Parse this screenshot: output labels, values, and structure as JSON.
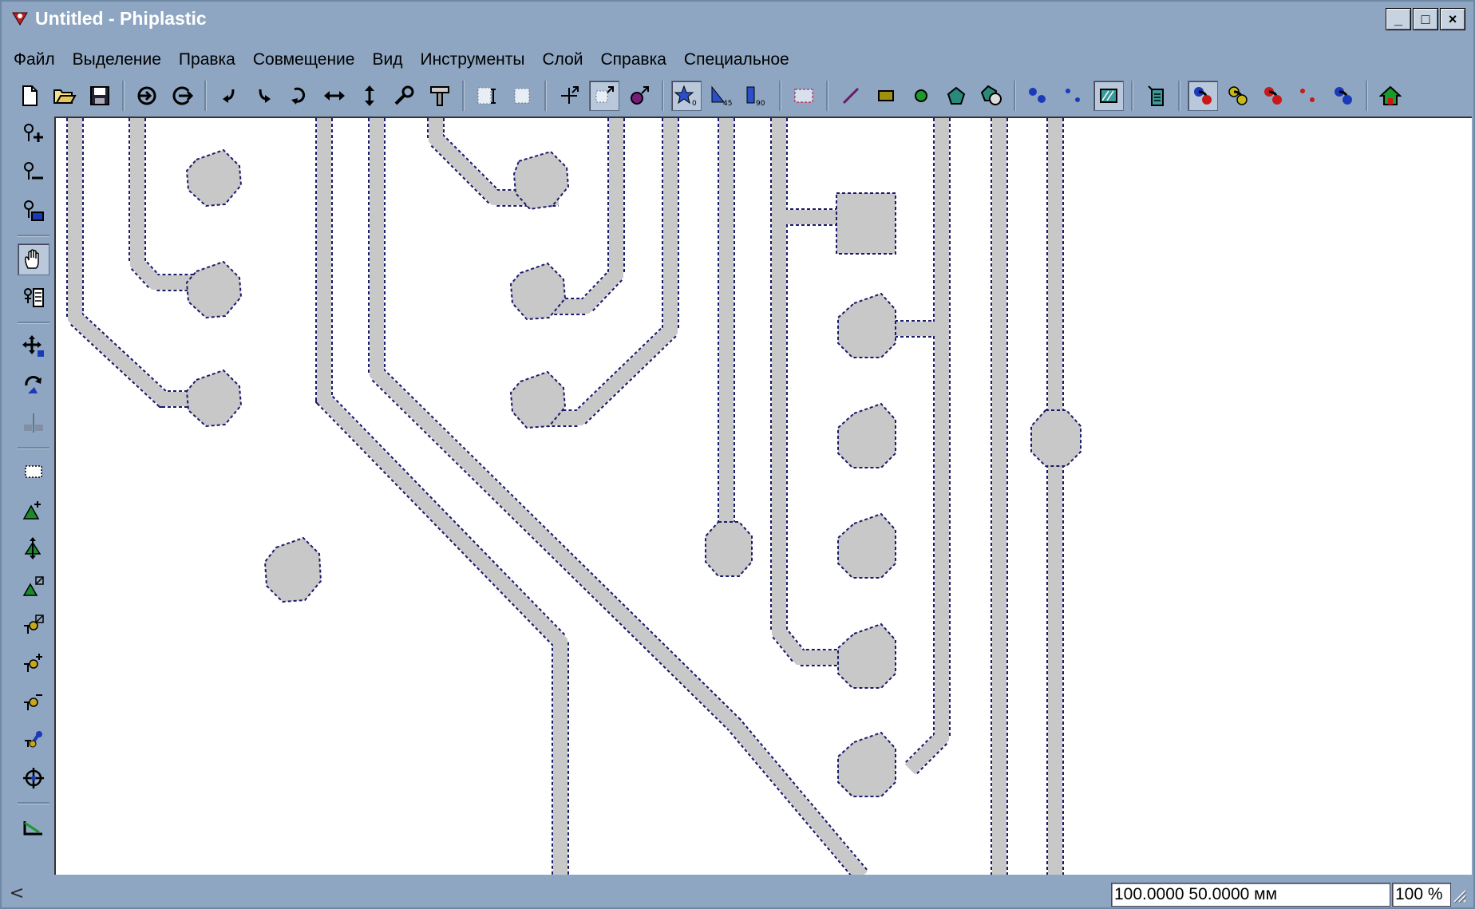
{
  "window": {
    "title": "Untitled - Phiplastic",
    "buttons": [
      "_",
      "□",
      "×"
    ]
  },
  "menu": {
    "items": [
      "Файл",
      "Выделение",
      "Правка",
      "Совмещение",
      "Вид",
      "Инструменты",
      "Слой",
      "Справка",
      "Специальное"
    ]
  },
  "toolbar": {
    "buttons": [
      "new-document",
      "open-folder",
      "save",
      "import",
      "export",
      "rotate-left",
      "rotate-right",
      "rotate-arc",
      "flip-horizontal",
      "flip-vertical",
      "wrench",
      "hammer",
      "grid-snap",
      "grid",
      "center-cross",
      "align-point",
      "node-tool",
      "star-0",
      "angle-45",
      "angle-90",
      "select-rect",
      "line",
      "rectangle",
      "circle",
      "polygon",
      "shape-union",
      "nodes",
      "points",
      "hatch",
      "layer-list",
      "route-a",
      "route-b",
      "route-c",
      "points-small",
      "route-d",
      "home"
    ]
  },
  "left_tools": {
    "buttons": [
      "zoom-in",
      "zoom-out",
      "zoom-window",
      "pan-hand",
      "properties",
      "move",
      "rotate",
      "mirror",
      "rect-select",
      "add-node",
      "move-node",
      "scale-node",
      "scale-point",
      "add-point",
      "remove-point",
      "rotate-point",
      "target",
      "measure"
    ]
  },
  "status": {
    "scroll_left": "<",
    "coords": "100.0000 50.0000 мм",
    "zoom": "100 %"
  },
  "colors": {
    "window_bg": "#8ea6c2",
    "canvas_bg": "#ffffff",
    "trace_fill": "#c8c8c8",
    "outline": "#1a1a6e"
  }
}
